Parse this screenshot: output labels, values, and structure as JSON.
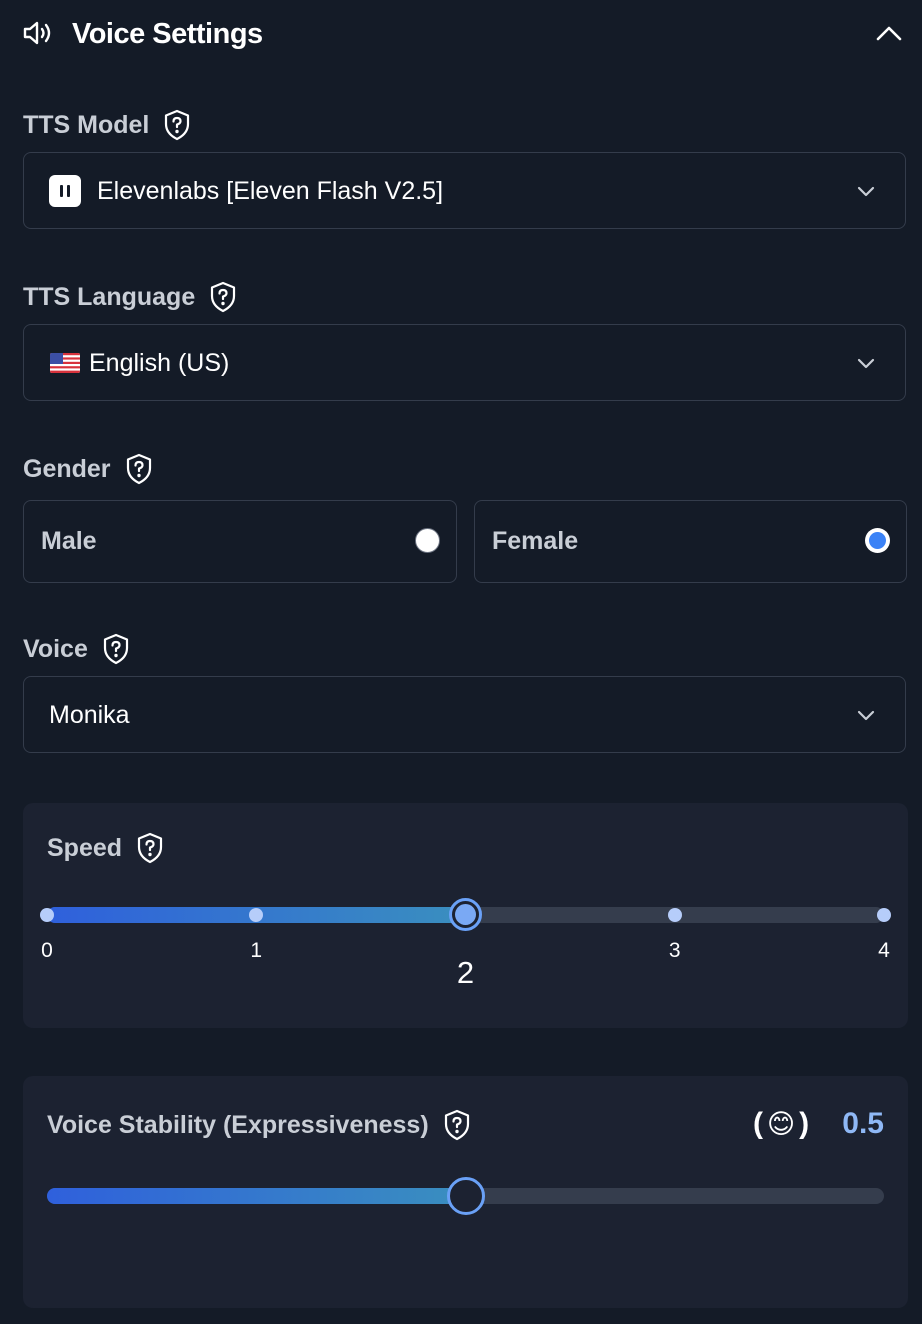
{
  "header": {
    "title": "Voice Settings",
    "icon": "speaker-icon",
    "collapse_icon": "chevron-up-icon"
  },
  "tts_model": {
    "label": "TTS Model",
    "value": "Elevenlabs [Eleven Flash V2.5]",
    "icon": "elevenlabs-logo-icon"
  },
  "tts_language": {
    "label": "TTS Language",
    "value": "English (US)",
    "flag": "us-flag-icon"
  },
  "gender": {
    "label": "Gender",
    "options": [
      {
        "label": "Male",
        "selected": false
      },
      {
        "label": "Female",
        "selected": true
      }
    ]
  },
  "voice": {
    "label": "Voice",
    "value": "Monika"
  },
  "speed": {
    "label": "Speed",
    "ticks": [
      "0",
      "1",
      "2",
      "3",
      "4"
    ],
    "value": 2,
    "min": 0,
    "max": 4
  },
  "stability": {
    "label": "Voice Stability (Expressiveness)",
    "emoji_open": "(",
    "emoji": "😊",
    "emoji_close": ")",
    "value_text": "0.5",
    "value": 0.5,
    "min": 0,
    "max": 1
  },
  "colors": {
    "background": "#141b27",
    "panel": "#1c2231",
    "accent": "#3b82f6",
    "value_text": "#8fb8f5"
  }
}
